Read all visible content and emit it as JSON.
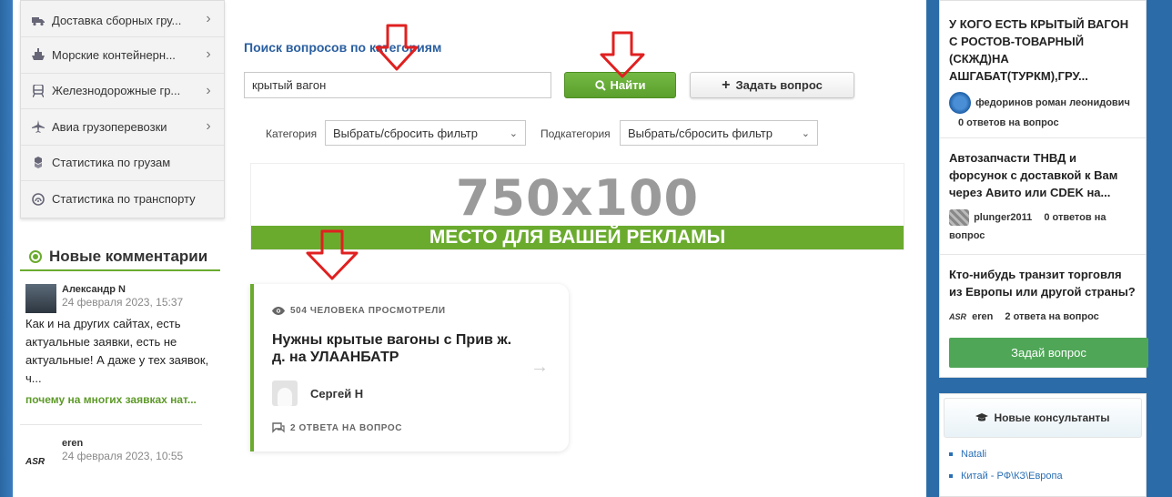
{
  "left_menu": {
    "items": [
      {
        "label": "Доставка сборных гру...",
        "icon": "truck-icon"
      },
      {
        "label": "Морские контейнерн...",
        "icon": "ship-icon"
      },
      {
        "label": "Железнодорожные гр...",
        "icon": "train-icon"
      },
      {
        "label": "Авиа грузоперевозки",
        "icon": "plane-icon"
      },
      {
        "label": "Статистика по грузам",
        "icon": "cubes-icon"
      },
      {
        "label": "Статистика по транспорту",
        "icon": "tachometer-icon"
      }
    ]
  },
  "comments": {
    "heading": "Новые комментарии",
    "items": [
      {
        "author": "Александр N",
        "date": "24 февраля 2023, 15:37",
        "text": "Как и на других сайтах, есть актуальные заявки, есть не актуальные! А даже у тех заявок, ч...",
        "link": "почему на многих заявках нат..."
      },
      {
        "author": "eren",
        "date": "24 февраля 2023, 10:55",
        "avatar_text": "ASR"
      }
    ]
  },
  "search": {
    "title": "Поиск вопросов по категориям",
    "query": "крытый вагон",
    "find_label": "Найти",
    "ask_label": "Задать вопрос",
    "category_label": "Категория",
    "category_value": "Выбрать/сбросить фильтр",
    "subcategory_label": "Подкатегория",
    "subcategory_value": "Выбрать/сбросить фильтр"
  },
  "banner": {
    "size": "750x100",
    "text": "МЕСТО ДЛЯ ВАШЕЙ РЕКЛАМЫ"
  },
  "question_card": {
    "views": "504 ЧЕЛОВЕКА ПРОСМОТРЕЛИ",
    "title": "Нужны крытые вагоны с Прив ж. д. на УЛААНБАТР",
    "author": "Сергей Н",
    "answers": "2 ОТВЕТА НА ВОПРОС"
  },
  "right_sidebar": {
    "questions": [
      {
        "title": "У КОГО ЕСТЬ КРЫТЫЙ ВАГОН С РОСТОВ-ТОВАРНЫЙ (СКЖД)НА АШГАБАТ(ТУРКМ),ГРУ...",
        "author": "федоринов роман леонидович",
        "answers": "0 ответов на вопрос"
      },
      {
        "title": "Автозапчасти ТНВД и форсунок с доставкой к Вам через Авито или CDEK на...",
        "author": "plunger2011",
        "answers": "0 ответов на вопрос"
      },
      {
        "title": "Кто-нибудь транзит торговля из Европы или другой страны?",
        "author": "eren",
        "answers": "2 ответа на вопрос",
        "avatar_text": "ASR"
      }
    ],
    "ask_button": "Задай вопрос",
    "consultants_heading": "Новые консультанты",
    "consultants": [
      "Natali",
      "Китай - РФ\\КЗ\\Европа"
    ]
  },
  "colors": {
    "accent_green": "#6aab2e",
    "link_blue": "#2a5fa0",
    "arrow_red": "#e02020"
  }
}
